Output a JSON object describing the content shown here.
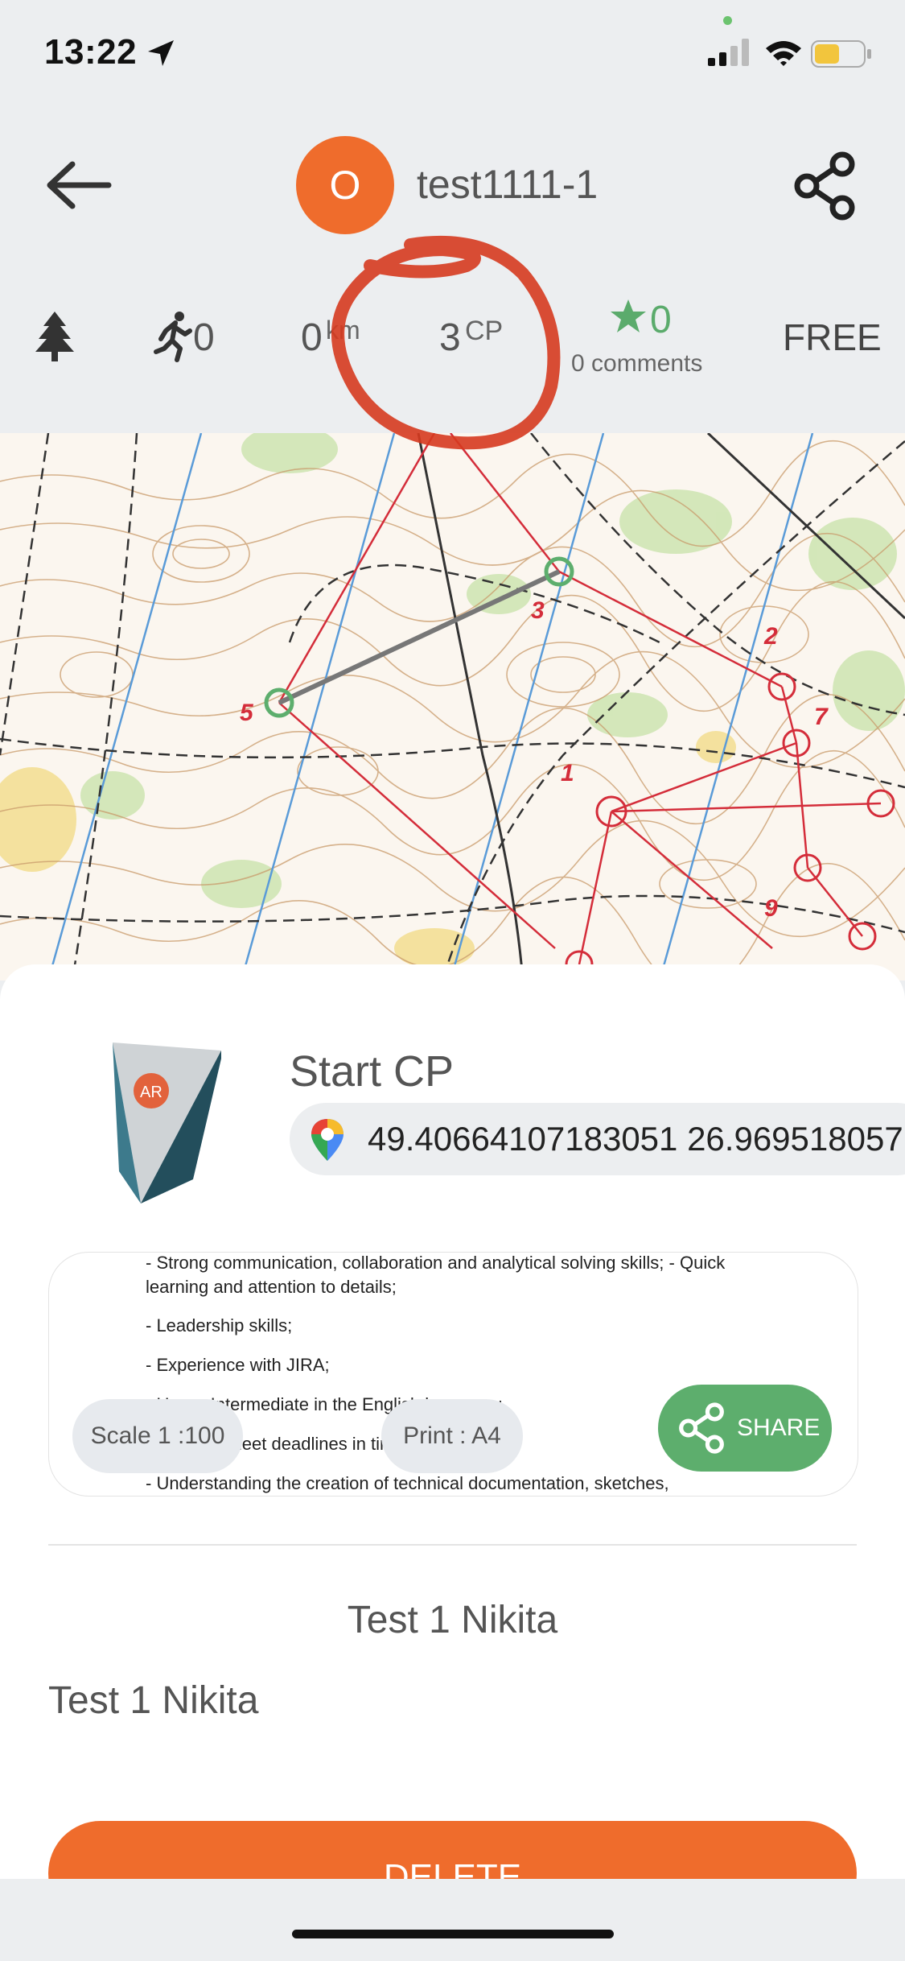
{
  "status_bar": {
    "time": "13:22"
  },
  "header": {
    "avatar_letter": "O",
    "title": "test1111-1"
  },
  "stats": {
    "runners": "0",
    "distance": "0",
    "distance_unit": "km",
    "checkpoints": "3",
    "checkpoints_unit": "CP",
    "rating": "0",
    "comments": "0 comments",
    "price": "FREE"
  },
  "checkpoint": {
    "name": "Start CP",
    "coordinates": "49.40664107183051 26.969518057"
  },
  "document": {
    "lines": [
      "- Strong communication, collaboration and analytical solving skills; - Quick",
      "learning and attention to details;",
      "- Leadership skills;",
      "- Experience with JIRA;",
      "- Upper-Intermediate in the English language;",
      "- Ability to meet deadlines in time-critical;",
      "- Understanding the creation of technical documentation, sketches,"
    ],
    "scale_label": "Scale 1 :100",
    "print_label": "Print : A4",
    "share_label": "SHARE"
  },
  "course": {
    "title": "Test 1 Nikita",
    "description": "Test 1 Nikita"
  },
  "actions": {
    "delete_label": "DELETE"
  },
  "colors": {
    "accent": "#ef6c2c",
    "green": "#5dae6d",
    "annotation": "#d63a1f"
  }
}
